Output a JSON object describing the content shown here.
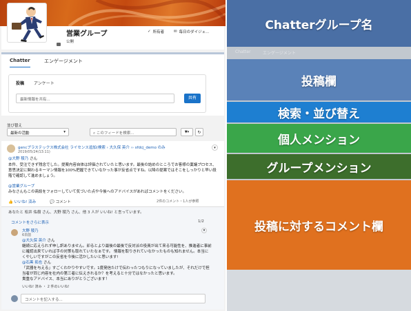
{
  "header": {
    "group_name": "営業グループ",
    "visibility": "公開",
    "owner_button": "所有者",
    "digest_button": "毎日のダイジェ..."
  },
  "tabs": [
    "Chatter",
    "エンゲージメント"
  ],
  "publisher": {
    "tabs": [
      "投稿",
      "アンケート"
    ],
    "placeholder": "最新情報を共有...",
    "share_button": "共有"
  },
  "feed_controls": {
    "sort_label": "並び替え",
    "sort_value": "最新の活動",
    "search_placeholder": "このフィードを検索...",
    "filter_icon": "filter-icon",
    "refresh_icon": "refresh-icon"
  },
  "post": {
    "author_line": "gencプラステックス株式会社 ライセンス追加(検索 › 大久保 英介 ›› sfdcj_demo のみ",
    "date": "2019/05/24/13:11)",
    "mention_person": "@大野 稜乃",
    "body_1": "さん",
    "body_2": "本件、受注できず残念でした。提案内容自体は評価されていたと思います。最後の詰めのところでお客様の稟議プロセス、意思決定に関わるキーマン情報を100%把握できていなかった事が反省点ですね。以降の提案ではそこをしっかりと早い段階で確認して進めましょう。",
    "mention_group": "@営業グループ",
    "body_3": "みなさんもこの商談をフォローしていて気づいた点や今後へのアドバイスがあればコメントをください。",
    "like": "いいね! 済み",
    "comment": "コメント",
    "stats": "2件のコメント・1人が参照"
  },
  "comments": {
    "likes_line": "あなたと 松井 佑樹 さん、大野 稜乃 さん、他 3 人が いいね! と言っています。",
    "more_link": "コメントをさらに表示",
    "count": "1/2",
    "author": "大野 稜乃",
    "time": "6日前",
    "mention_1": "@大久保 英介",
    "text_1": "さん",
    "text_2": "継続に応えられず申し訳ありません。卯るとより最後の最後で反対派の役員が出て来る可能性を、推進者に事前に確認出来ていれば手の対策も取れていたなぁです。 情報を取りきれていなかったものも知れません。本当にくやしいですがこの反省を今後に活かしたいと思います!",
    "mention_2": "@石黒 拓也",
    "text_3": "さん",
    "text_4": "「武器を与える」すごくわかりやすいです。1度発信たけで伝わったつもりになっていましたが、それだけで担当者が同じ内容を社内の第三者に伝えきれるか？を考えると十分ではなかったと思います。",
    "text_5": "貴重なアドバイス、本当にありがとうございます！",
    "action": "いいね! 済み ・ 2 件のいいね!",
    "new_placeholder": "コメントを記入する..."
  },
  "annotations": [
    {
      "label": "Chatterグループ名",
      "color": "#4a6fa5"
    },
    {
      "label": "投稿欄",
      "color": "#5a82b8"
    },
    {
      "label": "検索・並び替え",
      "color": "#1e7fd1"
    },
    {
      "label": "個人メンション",
      "color": "#3aa64a"
    },
    {
      "label": "グループメンション",
      "color": "#3d6e2c"
    },
    {
      "label": "投稿に対するコメント欄",
      "color": "#e0711f"
    }
  ]
}
